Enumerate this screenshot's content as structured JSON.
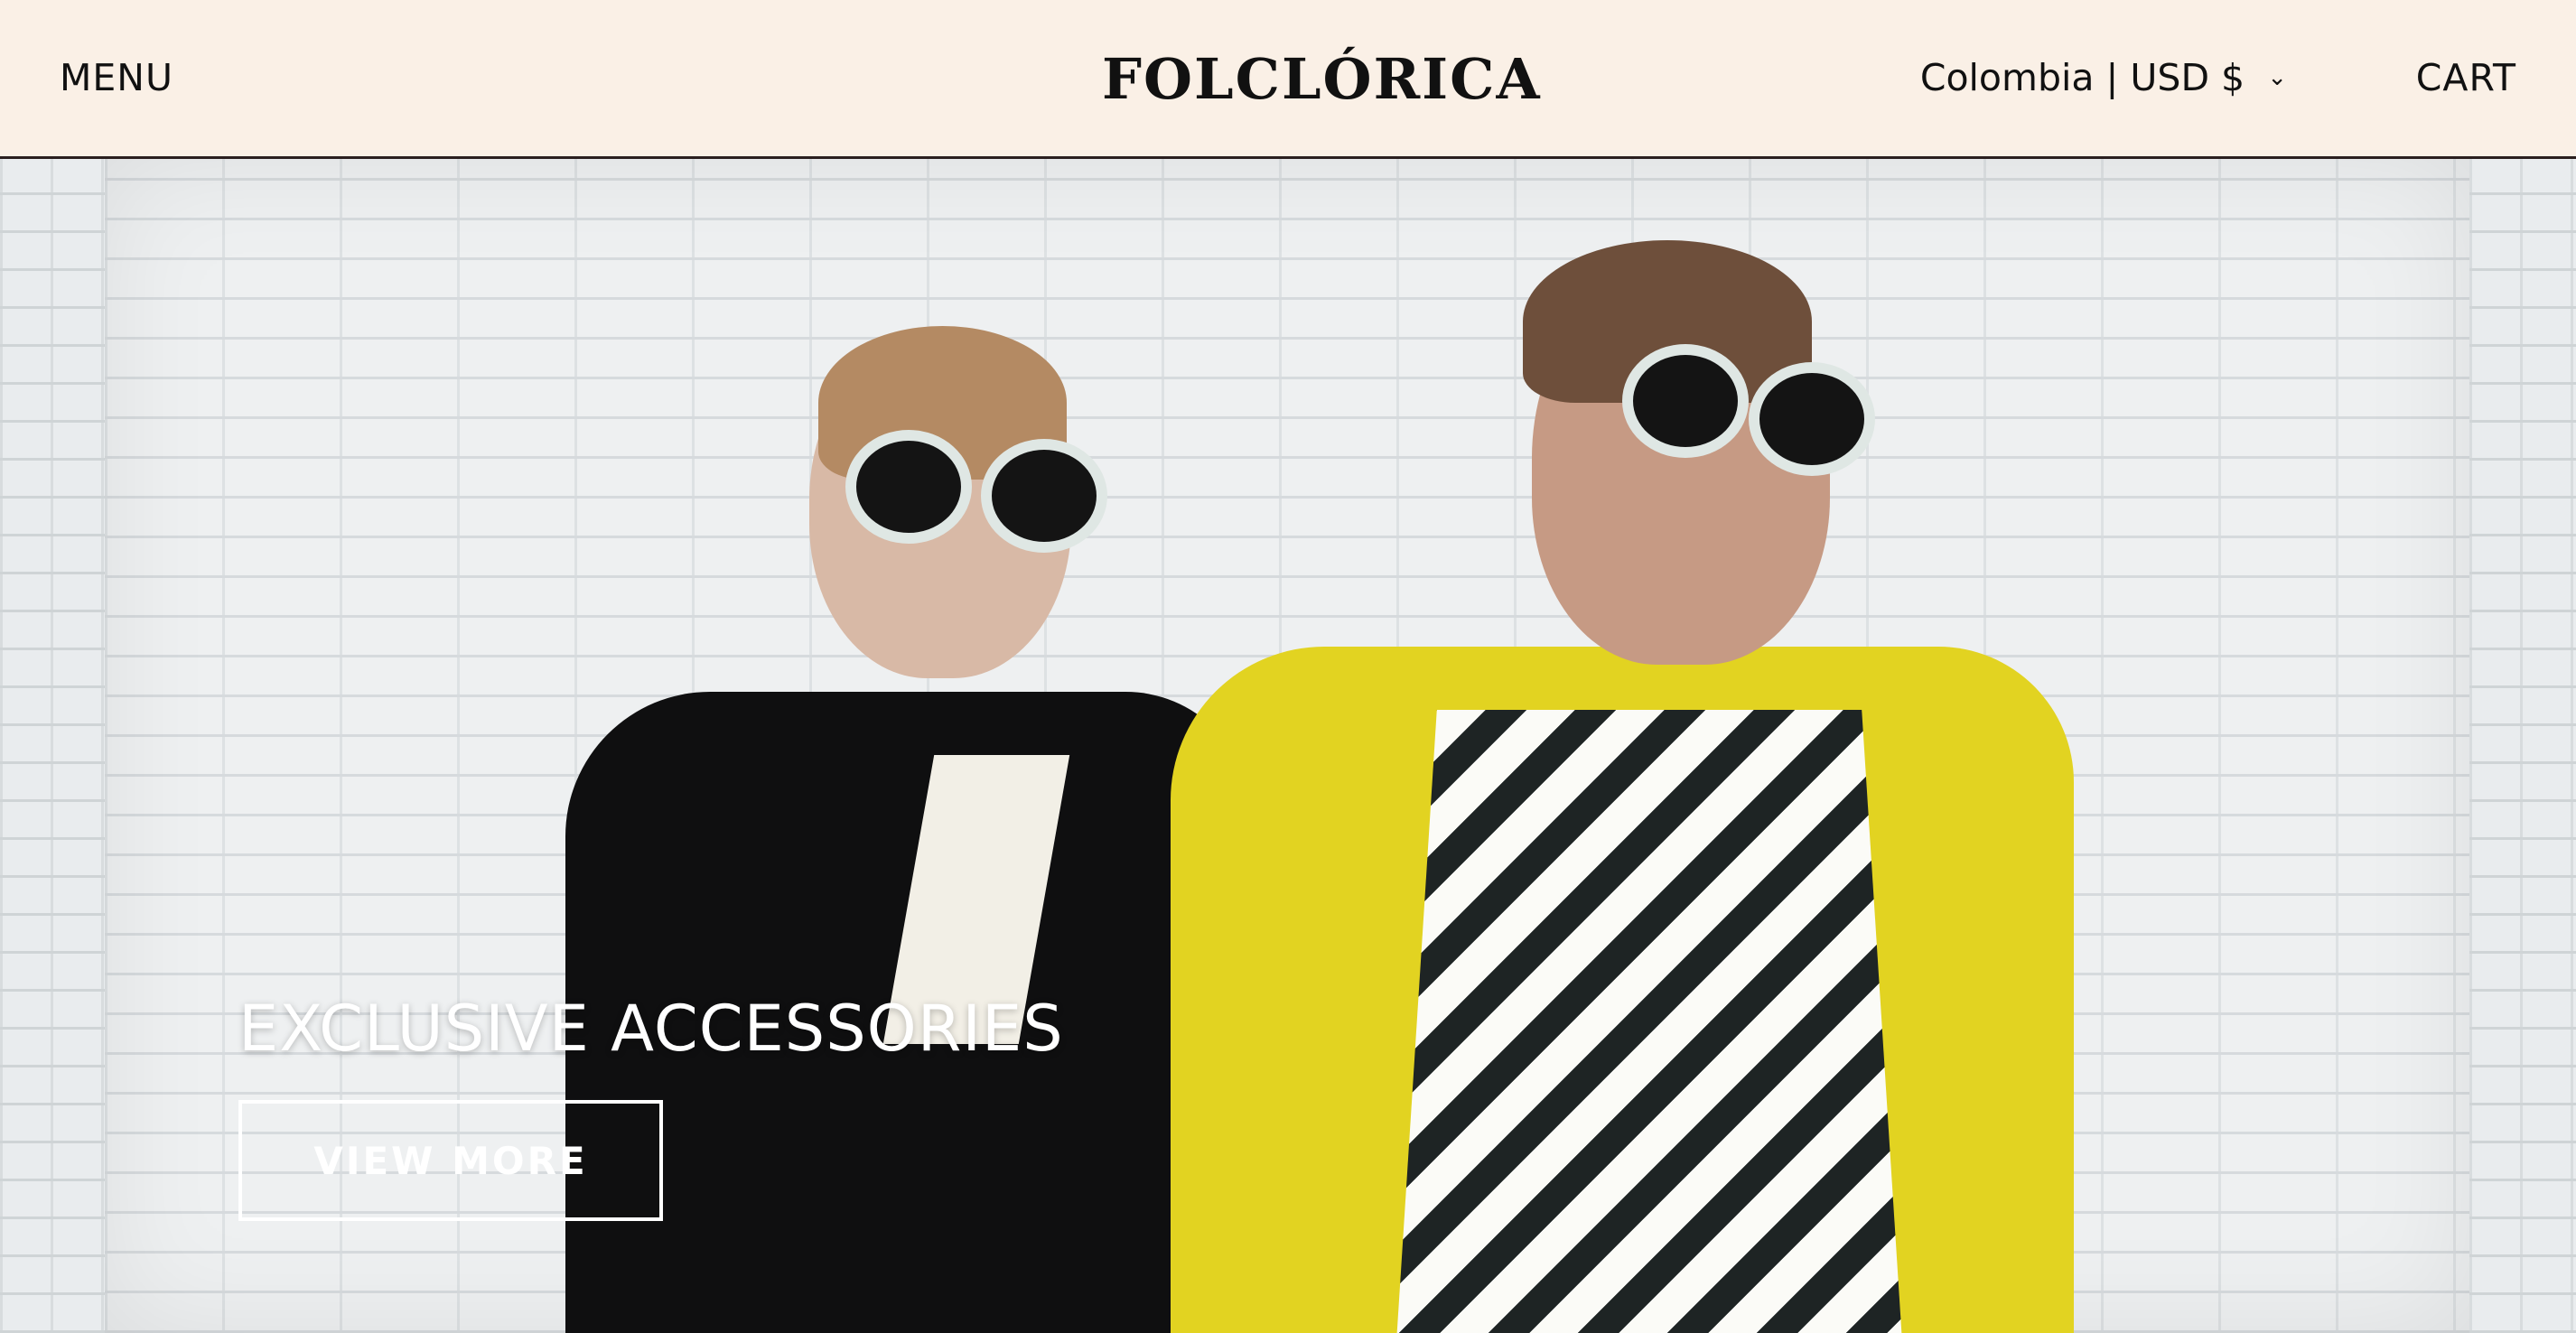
{
  "header": {
    "menu_label": "MENU",
    "logo_text": "FOLCLÓRICA",
    "locale": {
      "country": "Colombia",
      "separator": "|",
      "currency": "USD $"
    },
    "cart_label": "CART"
  },
  "hero": {
    "headline": "EXCLUSIVE ACCESSORIES",
    "button_label": "VIEW MORE"
  },
  "colors": {
    "header_background": "#faf0e6",
    "header_text": "#111111",
    "hero_text": "#ffffff"
  },
  "icons": {
    "currency_dropdown": "chevron-down-icon"
  }
}
